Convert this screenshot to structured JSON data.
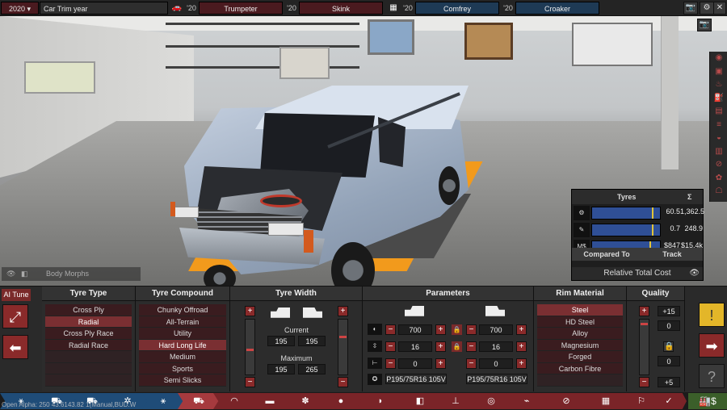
{
  "topbar": {
    "year": "2020",
    "trim_label": "Car Trim year",
    "slots": [
      {
        "year": "'20",
        "name": "Trumpeter"
      },
      {
        "year": "'20",
        "name": "Skink"
      },
      {
        "year": "'20",
        "name": "Comfrey"
      },
      {
        "year": "'20",
        "name": "Croaker"
      }
    ]
  },
  "tyres_panel": {
    "title": "Tyres",
    "sum_symbol": "Σ",
    "rows": [
      {
        "icon": "tyre-icon",
        "value": "60.5",
        "total": "1,362.5",
        "level": 0.88
      },
      {
        "icon": "wrench-icon",
        "value": "0.7",
        "total": "248.9",
        "level": 0.88
      },
      {
        "icon": "M$",
        "value": "$847",
        "total": "$15.4k",
        "level": 0.84
      }
    ],
    "tabs": [
      "Compared To",
      "Track"
    ],
    "footer": "Relative Total Cost"
  },
  "scene": {
    "body_morphs_label": "Body Morphs"
  },
  "ai_tune": "AI Tune",
  "columns": {
    "tyre_type": {
      "title": "Tyre Type",
      "items": [
        "Cross Ply",
        "Radial",
        "Cross Ply Race",
        "Radial Race"
      ],
      "selected": 1
    },
    "tyre_compound": {
      "title": "Tyre Compound",
      "items": [
        "Chunky Offroad",
        "All-Terrain",
        "Utility",
        "Hard Long Life",
        "Medium",
        "Sports",
        "Semi Slicks"
      ],
      "selected": 3
    },
    "tyre_width": {
      "title": "Tyre Width",
      "current_label": "Current",
      "maximum_label": "Maximum",
      "current_front": "195",
      "current_rear": "195",
      "max_front": "195",
      "max_rear": "265"
    },
    "parameters": {
      "title": "Parameters",
      "front": {
        "width": "700",
        "rim": "16",
        "offset": "0",
        "code": "P195/75R16 105V"
      },
      "rear": {
        "width": "700",
        "rim": "16",
        "offset": "0",
        "code": "P195/75R16 105V"
      }
    },
    "rim_material": {
      "title": "Rim Material",
      "items": [
        "Steel",
        "HD Steel",
        "Alloy",
        "Magnesium",
        "Forged",
        "Carbon Fibre"
      ],
      "selected": 0
    },
    "quality": {
      "title": "Quality",
      "top": "+15",
      "top_val": "0",
      "bottom_val": "0",
      "bottom": "+5"
    }
  },
  "version_text": "Open Alpha: 250 43.6143.82 1(Manual,BUD.W",
  "colors": {
    "accent_red": "#7a2a2a",
    "accent_blue": "#1f4c78",
    "bar_blue": "#2f4f96",
    "warn_yellow": "#e3b629"
  }
}
